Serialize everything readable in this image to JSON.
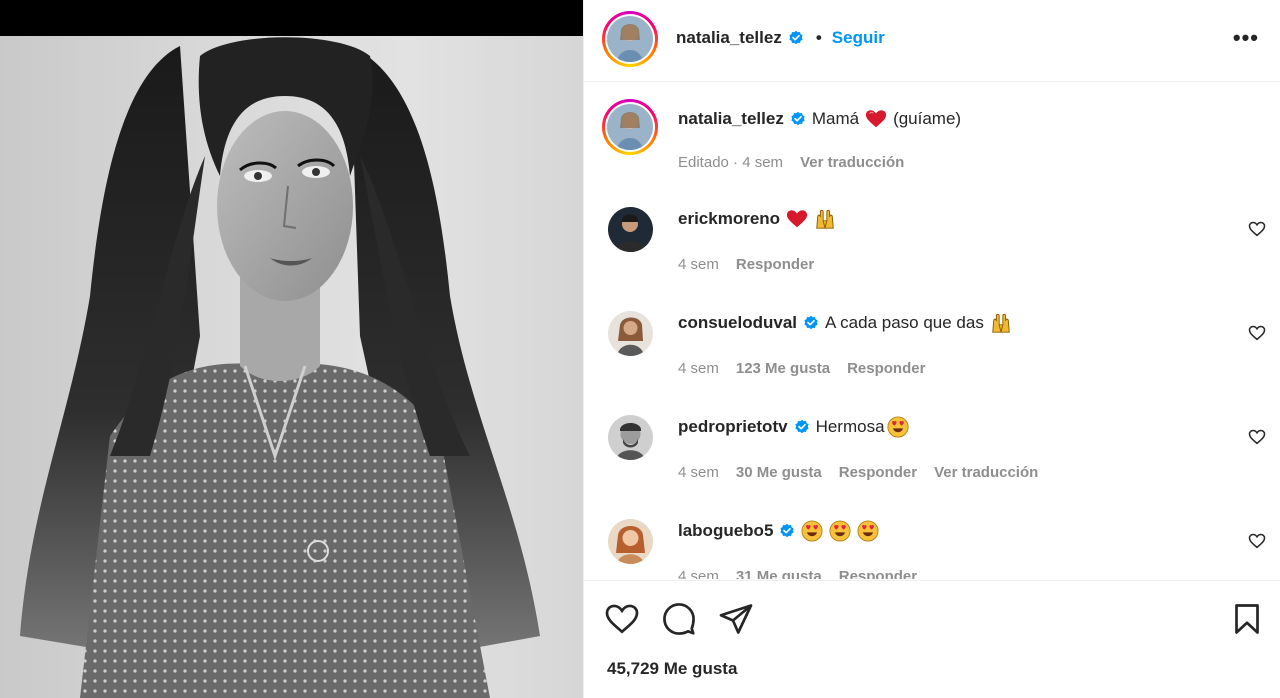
{
  "post": {
    "username": "natalia_tellez",
    "follow_label": "Seguir",
    "dot": "•",
    "more_label": "•••",
    "caption": {
      "username": "natalia_tellez",
      "text_before": "Mamá",
      "text_after": "(guíame)",
      "meta_edited": "Editado · 4 sem",
      "translate": "Ver traducción"
    },
    "comments": [
      {
        "username": "erickmoreno",
        "verified": false,
        "text": "",
        "time": "4 sem",
        "likes": "",
        "reply": "Responder",
        "translate": ""
      },
      {
        "username": "consueloduval",
        "verified": true,
        "text": "A cada paso que das",
        "time": "4 sem",
        "likes": "123 Me gusta",
        "reply": "Responder",
        "translate": ""
      },
      {
        "username": "pedroprietotv",
        "verified": true,
        "text": "Hermosa",
        "time": "4 sem",
        "likes": "30 Me gusta",
        "reply": "Responder",
        "translate": "Ver traducción"
      },
      {
        "username": "laboguebo5",
        "verified": true,
        "text": "",
        "time": "4 sem",
        "likes": "31 Me gusta",
        "reply": "Responder",
        "translate": ""
      }
    ],
    "likes_count": "45,729 Me gusta"
  },
  "colors": {
    "accent": "#0095f6",
    "text": "#262626",
    "muted": "#8e8e8e",
    "heart": "#ed4956"
  },
  "icons": {
    "verified": "verified-badge-icon",
    "like": "heart-icon",
    "comment": "comment-bubble-icon",
    "share": "paper-plane-icon",
    "save": "bookmark-icon",
    "more": "more-options-icon"
  }
}
